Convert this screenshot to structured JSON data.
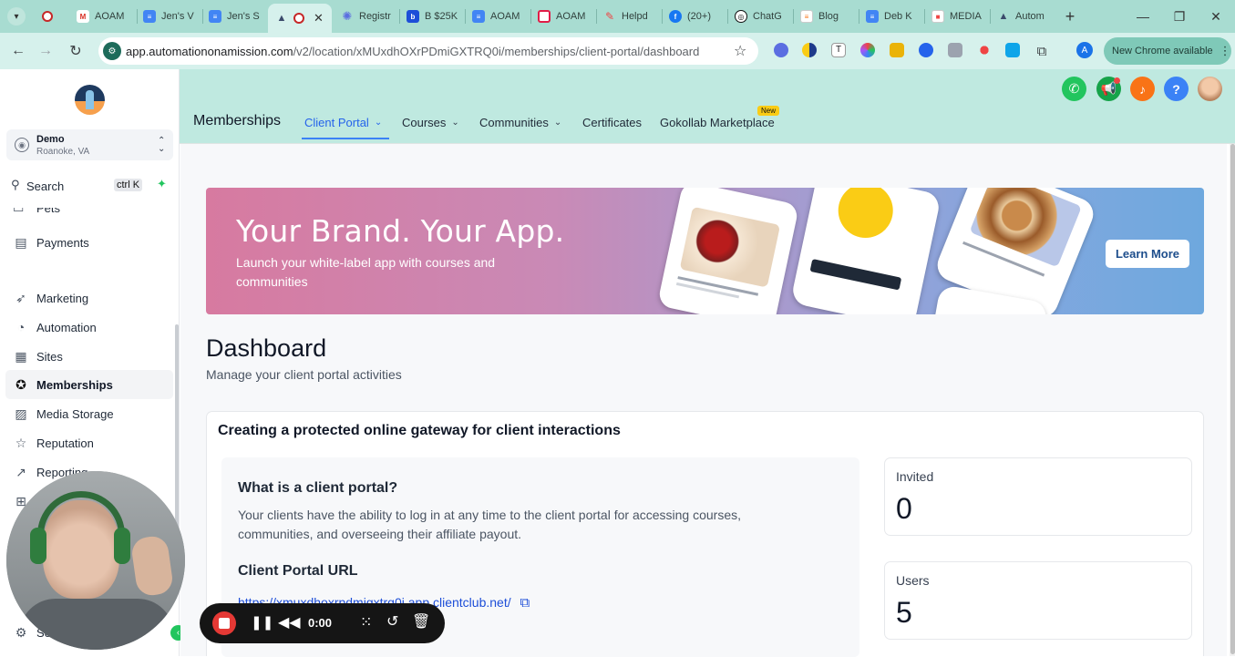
{
  "browser": {
    "tabs": [
      {
        "title": "AOAM",
        "icon": "gmail-icon",
        "color": "#d93025"
      },
      {
        "title": "Jen's V",
        "icon": "docs-icon",
        "color": "#4285f4"
      },
      {
        "title": "Jen's S",
        "icon": "docs-icon",
        "color": "#4285f4"
      },
      {
        "title": "",
        "icon": "app-icon",
        "color": "#3b4a6b"
      },
      {
        "title": "Registr",
        "icon": "gear-icon",
        "color": "#5b6ee1"
      },
      {
        "title": "B $25K",
        "icon": "box-icon",
        "color": "#1d4ed8"
      },
      {
        "title": "AOAM",
        "icon": "docs-icon",
        "color": "#4285f4"
      },
      {
        "title": "AOAM",
        "icon": "calendar-icon",
        "color": "#e11d48"
      },
      {
        "title": "Helpd",
        "icon": "helpdesk-icon",
        "color": "#ef4444"
      },
      {
        "title": "(20+)",
        "icon": "facebook-icon",
        "color": "#1877f2"
      },
      {
        "title": "ChatG",
        "icon": "chatgpt-icon",
        "color": "#111827"
      },
      {
        "title": "Blog",
        "icon": "blog-icon",
        "color": "#f97316"
      },
      {
        "title": "Deb K",
        "icon": "docs-icon",
        "color": "#4285f4"
      },
      {
        "title": "MEDIA",
        "icon": "media-icon",
        "color": "#ef4444"
      },
      {
        "title": "Autom",
        "icon": "app-icon",
        "color": "#3b4a6b"
      }
    ],
    "url_host": "app.automationonamission.com",
    "url_path": "/v2/location/xMUxdhOXrPDmiGXTRQ0i/memberships/client-portal/dashboard",
    "profile_letter": "A",
    "update_label": "New Chrome available"
  },
  "sidebar": {
    "account_name": "Demo",
    "account_location": "Roanoke, VA",
    "search_label": "Search",
    "search_shortcut": "ctrl K",
    "partial_item": "Pets",
    "items": [
      {
        "label": "Payments",
        "icon": "payments-icon"
      },
      {
        "label": "Marketing",
        "icon": "marketing-icon"
      },
      {
        "label": "Automation",
        "icon": "automation-icon"
      },
      {
        "label": "Sites",
        "icon": "sites-icon"
      },
      {
        "label": "Memberships",
        "icon": "memberships-icon"
      },
      {
        "label": "Media Storage",
        "icon": "media-storage-icon"
      },
      {
        "label": "Reputation",
        "icon": "star-icon"
      },
      {
        "label": "Reporting",
        "icon": "reporting-icon"
      }
    ],
    "settings_partial": "Se"
  },
  "topnav": {
    "section": "Memberships",
    "items": [
      "Client Portal",
      "Courses",
      "Communities",
      "Certificates",
      "Gokollab Marketplace"
    ],
    "new_badge": "New"
  },
  "banner": {
    "headline": "Your Brand. Your App.",
    "subtext": "Launch your white-label app with courses and communities",
    "cta": "Learn More"
  },
  "dashboard": {
    "title": "Dashboard",
    "subtitle": "Manage your client portal activities",
    "card_heading": "Creating a protected online gateway for client interactions",
    "what_heading": "What is a client portal?",
    "what_text": "Your clients have the ability to log in at any time to the client portal for accessing courses, communities, and overseeing their affiliate payout.",
    "url_heading": "Client Portal URL",
    "portal_url": "https://xmuxdhoxrpdmigxtrq0i.app.clientclub.net/",
    "stats": [
      {
        "label": "Invited",
        "value": "0"
      },
      {
        "label": "Users",
        "value": "5"
      }
    ]
  },
  "recorder": {
    "time": "0:00"
  }
}
